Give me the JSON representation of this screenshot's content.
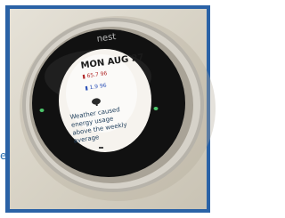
{
  "photo": {
    "brand_text": "nest",
    "screen_date": "MON AUG 27",
    "temp_line_1": "▮ 65.7 96",
    "temp_line_2": "▮ 1.9 96",
    "message": "Weather caused energy usage above the weekly average",
    "edge_letter": "e",
    "colors": {
      "frame": "#2a62a6",
      "wall": "#d9d4c7",
      "bezel": "#b7b3aa",
      "display_ring": "#111111",
      "screen": "#f6f3ee",
      "date_text": "#1b1b1b",
      "accent_red": "#b12929",
      "accent_blue": "#2d52b8"
    }
  }
}
